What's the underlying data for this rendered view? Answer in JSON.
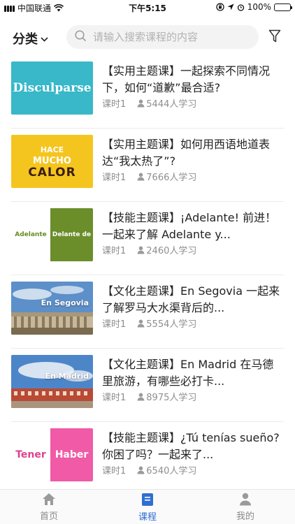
{
  "status": {
    "carrier": "中国联通",
    "time": "下午5:15",
    "battery": "100%",
    "battery_fraction": 1.0
  },
  "header": {
    "category_label": "分类",
    "search_placeholder": "请输入搜索课程的内容"
  },
  "courses": [
    {
      "title": "【实用主题课】一起探索不同情况下，如何“道歉”最合适?",
      "lessons": "课时1",
      "learners": "5444人学习",
      "thumb": {
        "text": "Disculparse",
        "color": "#38b8c9"
      }
    },
    {
      "title": "【实用主题课】如何用西语地道表达“我太热了”?",
      "lessons": "课时1",
      "learners": "7666人学习",
      "thumb": {
        "line1": "HACE",
        "line2": "MUCHO",
        "line3": "CALOR",
        "color": "#f5c51f"
      }
    },
    {
      "title": "【技能主题课】¡Adelante! 前进！一起来了解 Adelante y...",
      "lessons": "课时1",
      "learners": "2460人学习",
      "thumb": {
        "left": "Adelante",
        "right": "Delante de",
        "color": "#6b8e2b"
      }
    },
    {
      "title": "【文化主题课】En Segovia 一起来了解罗马大水渠背后的...",
      "lessons": "课时1",
      "learners": "5554人学习",
      "thumb": {
        "caption": "En Segovia"
      }
    },
    {
      "title": "【文化主题课】En Madrid 在马德里旅游，有哪些必打卡...",
      "lessons": "课时1",
      "learners": "8975人学习",
      "thumb": {
        "caption": "En Madrid"
      }
    },
    {
      "title": "【技能主题课】¿Tú tenías sueño? 你困了吗？一起来了...",
      "lessons": "课时1",
      "learners": "6540人学习",
      "thumb": {
        "left": "Tener",
        "right": "Haber",
        "color": "#f05aa6"
      }
    }
  ],
  "tabbar": {
    "tabs": [
      {
        "label": "首页",
        "icon": "home-icon",
        "active": false
      },
      {
        "label": "课程",
        "icon": "book-icon",
        "active": true
      },
      {
        "label": "我的",
        "icon": "profile-icon",
        "active": false
      }
    ],
    "active_color": "#2f6fd1"
  }
}
